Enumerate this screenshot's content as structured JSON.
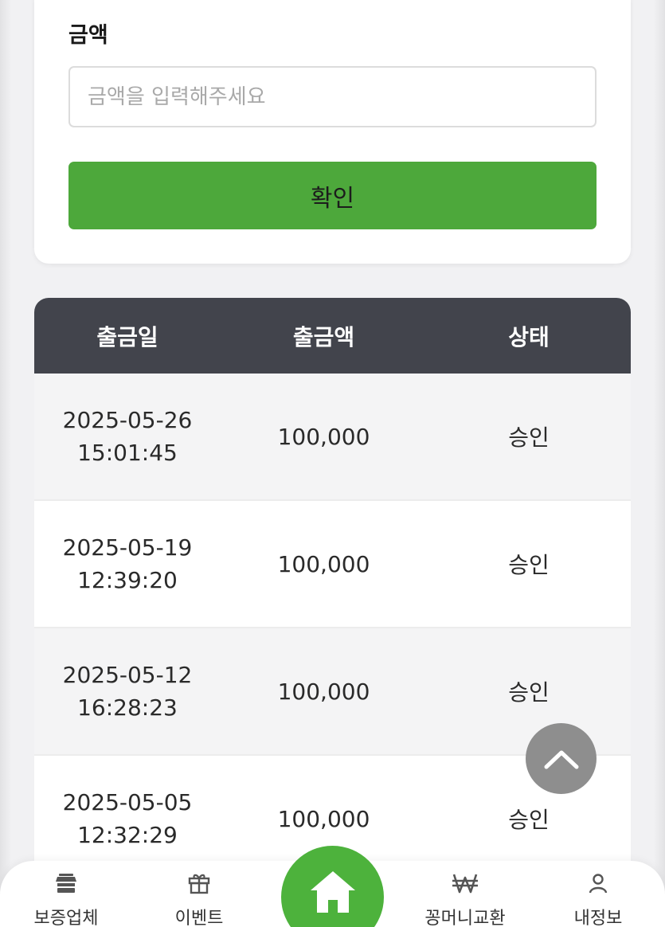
{
  "form": {
    "amount_label": "금액",
    "amount_placeholder": "금액을 입력해주세요",
    "amount_value": "",
    "confirm_label": "확인"
  },
  "table": {
    "headers": [
      "출금일",
      "출금액",
      "상태"
    ],
    "rows": [
      {
        "date": "2025-05-26",
        "time": "15:01:45",
        "amount": "100,000",
        "status": "승인"
      },
      {
        "date": "2025-05-19",
        "time": "12:39:20",
        "amount": "100,000",
        "status": "승인"
      },
      {
        "date": "2025-05-12",
        "time": "16:28:23",
        "amount": "100,000",
        "status": "승인"
      },
      {
        "date": "2025-05-05",
        "time": "12:32:29",
        "amount": "100,000",
        "status": "승인"
      }
    ]
  },
  "scroll_top": {
    "icon": "chevron-up-icon"
  },
  "bottom_nav": {
    "items": [
      {
        "label": "보증업체",
        "icon": "store-icon"
      },
      {
        "label": "이벤트",
        "icon": "gift-icon"
      },
      {
        "label": "꽁머니교환",
        "icon": "won-icon"
      },
      {
        "label": "내정보",
        "icon": "user-icon"
      }
    ],
    "home_icon": "home-icon"
  },
  "colors": {
    "accent_green": "#4da83b",
    "header_dark": "#42444c",
    "scroll_button": "#8e8e8e"
  }
}
